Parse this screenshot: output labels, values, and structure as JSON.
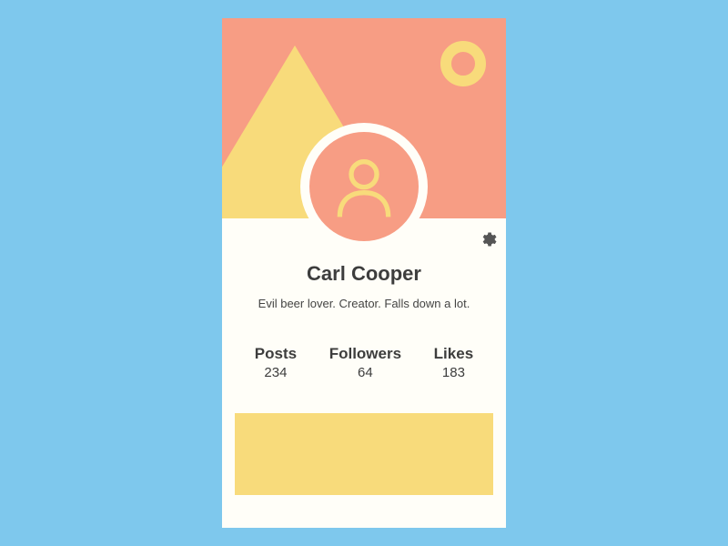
{
  "profile": {
    "name": "Carl Cooper",
    "bio": "Evil beer lover. Creator. Falls down a lot."
  },
  "stats": {
    "posts": {
      "label": "Posts",
      "value": "234"
    },
    "followers": {
      "label": "Followers",
      "value": "64"
    },
    "likes": {
      "label": "Likes",
      "value": "183"
    }
  },
  "colors": {
    "background": "#7ec8ed",
    "hero": "#f79d84",
    "accent": "#f8db7b",
    "card": "#fffef8"
  }
}
